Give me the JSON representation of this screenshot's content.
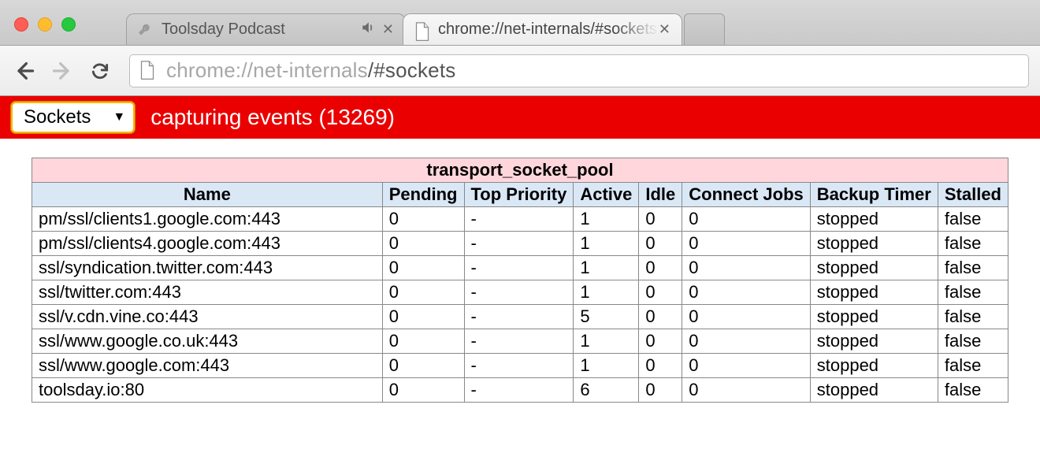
{
  "tabs": [
    {
      "title": "Toolsday Podcast",
      "active": false,
      "audio": true
    },
    {
      "title": "chrome://net-internals/#sockets",
      "active": true,
      "audio": false
    }
  ],
  "url": {
    "scheme": "chrome://net-internals",
    "path": "/#sockets"
  },
  "section_select": {
    "selected": "Sockets"
  },
  "capture_status": {
    "label": "capturing events",
    "count": 13269
  },
  "table": {
    "title": "transport_socket_pool",
    "columns": [
      "Name",
      "Pending",
      "Top Priority",
      "Active",
      "Idle",
      "Connect Jobs",
      "Backup Timer",
      "Stalled"
    ],
    "rows": [
      {
        "name": "pm/ssl/clients1.google.com:443",
        "pending": 0,
        "top_priority": "-",
        "active": 1,
        "idle": 0,
        "connect_jobs": 0,
        "backup_timer": "stopped",
        "stalled": "false"
      },
      {
        "name": "pm/ssl/clients4.google.com:443",
        "pending": 0,
        "top_priority": "-",
        "active": 1,
        "idle": 0,
        "connect_jobs": 0,
        "backup_timer": "stopped",
        "stalled": "false"
      },
      {
        "name": "ssl/syndication.twitter.com:443",
        "pending": 0,
        "top_priority": "-",
        "active": 1,
        "idle": 0,
        "connect_jobs": 0,
        "backup_timer": "stopped",
        "stalled": "false"
      },
      {
        "name": "ssl/twitter.com:443",
        "pending": 0,
        "top_priority": "-",
        "active": 1,
        "idle": 0,
        "connect_jobs": 0,
        "backup_timer": "stopped",
        "stalled": "false"
      },
      {
        "name": "ssl/v.cdn.vine.co:443",
        "pending": 0,
        "top_priority": "-",
        "active": 5,
        "idle": 0,
        "connect_jobs": 0,
        "backup_timer": "stopped",
        "stalled": "false"
      },
      {
        "name": "ssl/www.google.co.uk:443",
        "pending": 0,
        "top_priority": "-",
        "active": 1,
        "idle": 0,
        "connect_jobs": 0,
        "backup_timer": "stopped",
        "stalled": "false"
      },
      {
        "name": "ssl/www.google.com:443",
        "pending": 0,
        "top_priority": "-",
        "active": 1,
        "idle": 0,
        "connect_jobs": 0,
        "backup_timer": "stopped",
        "stalled": "false"
      },
      {
        "name": "toolsday.io:80",
        "pending": 0,
        "top_priority": "-",
        "active": 6,
        "idle": 0,
        "connect_jobs": 0,
        "backup_timer": "stopped",
        "stalled": "false"
      }
    ]
  }
}
